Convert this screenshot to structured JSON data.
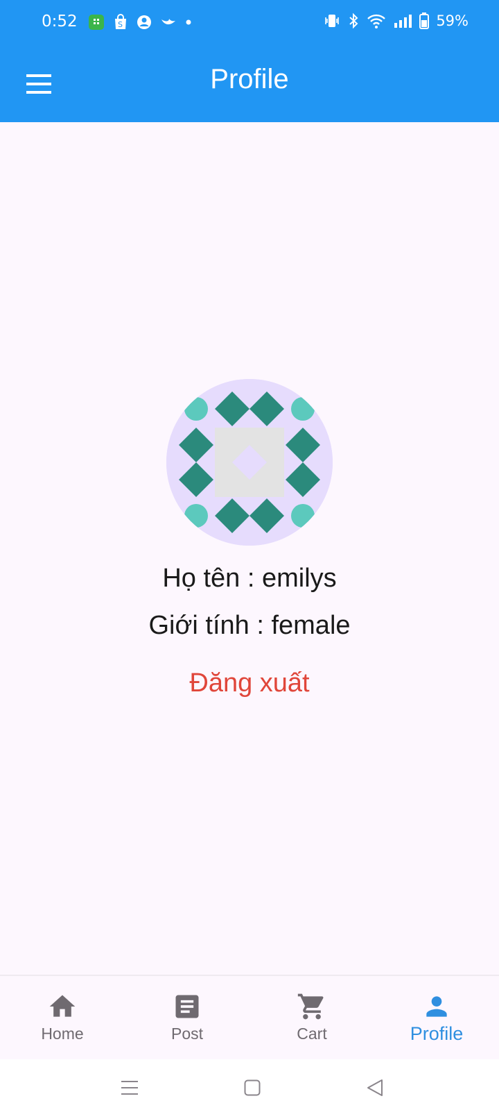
{
  "status_bar": {
    "time": "0:52",
    "battery_percent": "59%",
    "left_icons": [
      "app-notification-icon",
      "shopping-bag-icon",
      "account-circle-icon",
      "bird-icon",
      "dot-icon"
    ],
    "right_icons": [
      "vibrate-icon",
      "bluetooth-icon",
      "wifi-icon",
      "signal-icon",
      "battery-icon"
    ]
  },
  "app_bar": {
    "title": "Profile",
    "background_color": "#2196f3"
  },
  "profile": {
    "name_text": "Họ tên : emilys",
    "gender_text": "Giới tính : female",
    "logout_label": "Đăng xuất",
    "logout_color": "#e0463a"
  },
  "bottom_nav": {
    "items": [
      {
        "label": "Home",
        "icon": "home-icon",
        "active": false
      },
      {
        "label": "Post",
        "icon": "article-icon",
        "active": false
      },
      {
        "label": "Cart",
        "icon": "cart-icon",
        "active": false
      },
      {
        "label": "Profile",
        "icon": "person-icon",
        "active": true
      }
    ],
    "active_color": "#2f8fe0",
    "inactive_color": "#6f6a70"
  }
}
